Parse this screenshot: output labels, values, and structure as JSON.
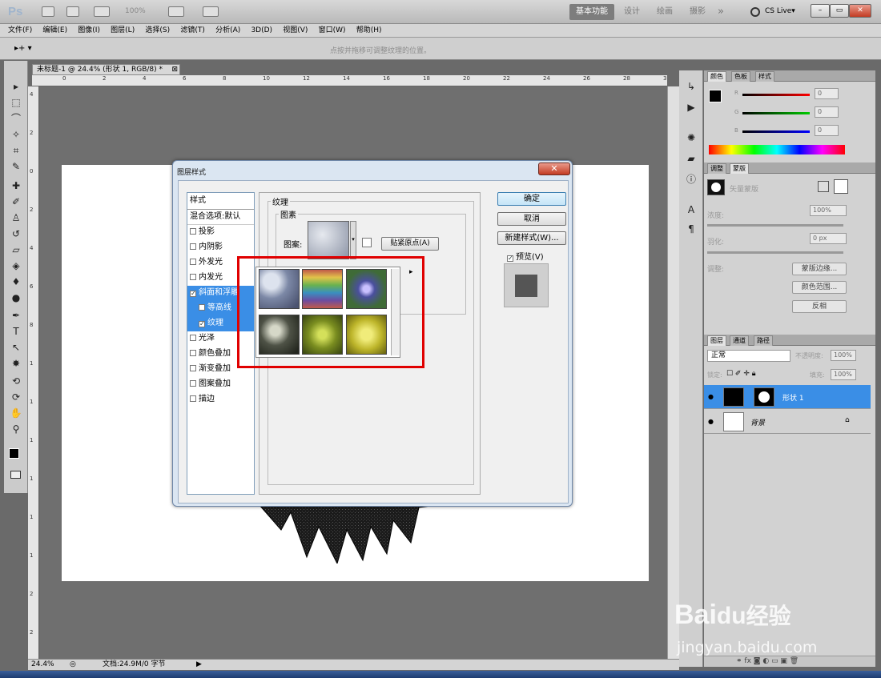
{
  "app": {
    "logo": "Ps",
    "zoom": "100%",
    "workspace": [
      "基本功能",
      "设计",
      "绘画",
      "摄影"
    ],
    "more": "»",
    "cslive": "CS Live▾",
    "win": [
      "–",
      "▭",
      "✕"
    ]
  },
  "menu": [
    "文件(F)",
    "编辑(E)",
    "图像(I)",
    "图层(L)",
    "选择(S)",
    "滤镜(T)",
    "分析(A)",
    "3D(D)",
    "视图(V)",
    "窗口(W)",
    "帮助(H)"
  ],
  "options": {
    "tool": "▸+ ▾",
    "hint": "点按并拖移可调整纹理的位置。"
  },
  "document": {
    "tab": "未标题-1 @ 24.4% (形状 1, RGB/8) *",
    "ruler_top": [
      "0",
      "2",
      "4",
      "6",
      "8",
      "10",
      "12",
      "14",
      "16",
      "18",
      "20",
      "22",
      "24",
      "26",
      "28",
      "30"
    ],
    "ruler_left": [
      "4",
      "2",
      "0",
      "2",
      "4",
      "6",
      "8",
      "1",
      "1",
      "1",
      "1",
      "1",
      "1",
      "2",
      "2",
      "2"
    ]
  },
  "status": {
    "zoom": "24.4%",
    "doc": "文档:24.9M/0 字节"
  },
  "dialog": {
    "title": "图层样式",
    "styles_header": "样式",
    "blend": "混合选项:默认",
    "items": [
      {
        "label": "投影",
        "checked": false,
        "indent": false,
        "selected": false
      },
      {
        "label": "内阴影",
        "checked": false,
        "indent": false,
        "selected": false
      },
      {
        "label": "外发光",
        "checked": false,
        "indent": false,
        "selected": false
      },
      {
        "label": "内发光",
        "checked": false,
        "indent": false,
        "selected": false
      },
      {
        "label": "斜面和浮雕",
        "checked": true,
        "indent": false,
        "selected": true
      },
      {
        "label": "等高线",
        "checked": false,
        "indent": true,
        "selected": true
      },
      {
        "label": "纹理",
        "checked": true,
        "indent": true,
        "selected": true
      },
      {
        "label": "光泽",
        "checked": false,
        "indent": false,
        "selected": false
      },
      {
        "label": "颜色叠加",
        "checked": false,
        "indent": false,
        "selected": false
      },
      {
        "label": "渐变叠加",
        "checked": false,
        "indent": false,
        "selected": false
      },
      {
        "label": "图案叠加",
        "checked": false,
        "indent": false,
        "selected": false
      },
      {
        "label": "描边",
        "checked": false,
        "indent": false,
        "selected": false
      }
    ],
    "group_texture": "纹理",
    "group_pattern": "图素",
    "pattern_label": "图案:",
    "snap_button": "贴紧原点(A)",
    "ok": "确定",
    "cancel": "取消",
    "new_style": "新建样式(W)...",
    "preview": "预览(V)"
  },
  "picker": {
    "patterns": [
      {
        "name": "bubbles",
        "color": "#8796b6"
      },
      {
        "name": "rainbow",
        "color": "#7fa06f"
      },
      {
        "name": "blue-flowers",
        "color": "#5a5fae"
      },
      {
        "name": "ivy",
        "color": "#6f7365"
      },
      {
        "name": "green-leaves",
        "color": "#8a9a2a"
      },
      {
        "name": "yellow-foliage",
        "color": "#b8b52a"
      }
    ]
  },
  "panels": {
    "color_tabs": [
      "颜色",
      "色板",
      "样式"
    ],
    "rgb": [
      "R",
      "G",
      "B"
    ],
    "rgb_values": [
      "0",
      "0",
      "0"
    ],
    "adjust_tabs": [
      "调整",
      "蒙版"
    ],
    "mask_label": "矢量蒙版",
    "density_label": "浓度:",
    "density": "100%",
    "feather_label": "羽化:",
    "feather": "0 px",
    "refine_label": "调整:",
    "mask_edge": "蒙版边缘...",
    "color_range": "颜色范围...",
    "invert": "反相",
    "layer_tabs": [
      "图层",
      "通道",
      "路径"
    ],
    "blend_mode": "正常",
    "opacity_label": "不透明度:",
    "opacity": "100%",
    "lock_label": "锁定:",
    "fill_label": "填充:",
    "fill": "100%",
    "layers": [
      {
        "name": "形状 1",
        "selected": true
      },
      {
        "name": "背景",
        "selected": false
      }
    ]
  },
  "watermark": {
    "brand": "Bai",
    "brand2": "du",
    "cn": "经验",
    "url": "jingyan.baidu.com"
  },
  "colors": {
    "accent": "#3a8ee6",
    "highlight": "#e00000"
  }
}
